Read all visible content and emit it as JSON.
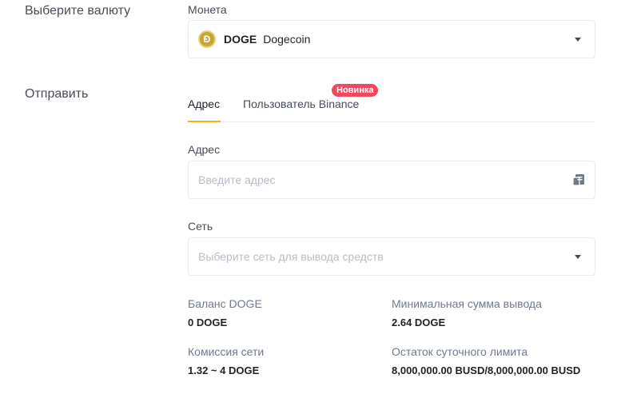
{
  "sections": {
    "currency_label": "Выберите валюту",
    "send_label": "Отправить"
  },
  "coin": {
    "field_label": "Монета",
    "code": "DOGE",
    "name": "Dogecoin",
    "icon_letter": "Ð",
    "icon": "dogecoin-icon"
  },
  "tabs": [
    {
      "label": "Адрес",
      "active": true
    },
    {
      "label": "Пользователь Binance",
      "active": false,
      "badge": "Новинка"
    }
  ],
  "address": {
    "field_label": "Адрес",
    "placeholder": "Введите адрес",
    "icon": "paste-icon"
  },
  "network": {
    "field_label": "Сеть",
    "placeholder": "Выберите сеть для вывода средств"
  },
  "info": {
    "balance_label": "Баланс DOGE",
    "balance_value": "0 DOGE",
    "min_label": "Минимальная сумма вывода",
    "min_value": "2.64 DOGE",
    "fee_label": "Комиссия сети",
    "fee_value": "1.32 ~ 4 DOGE",
    "limit_label": "Остаток суточного лимита",
    "limit_value": "8,000,000.00 BUSD/8,000,000.00 BUSD"
  },
  "colors": {
    "accent": "#f0b90b",
    "badge": "#f6465d"
  }
}
